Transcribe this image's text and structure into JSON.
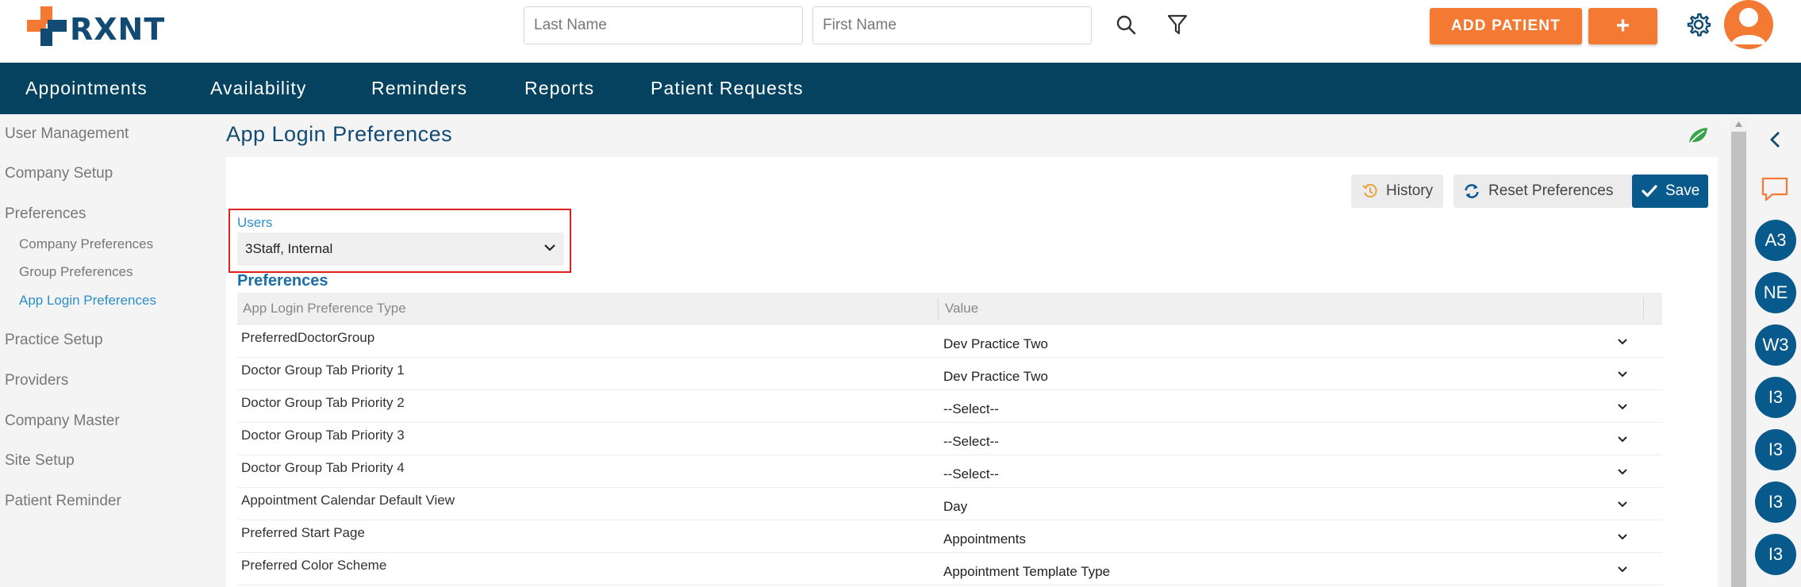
{
  "brand": {
    "name": "RXNT",
    "primary_color": "#05425f",
    "accent_color": "#f47a34"
  },
  "header": {
    "last_name_placeholder": "Last Name",
    "first_name_placeholder": "First Name",
    "add_patient_label": "ADD PATIENT",
    "plus_label": "+",
    "icons": [
      "search-icon",
      "filter-icon",
      "gear-icon",
      "user-avatar-icon"
    ]
  },
  "nav": {
    "items": [
      "Appointments",
      "Availability",
      "Reminders",
      "Reports",
      "Patient Requests"
    ]
  },
  "sidebar": {
    "items": [
      {
        "label": "User Management"
      },
      {
        "label": "Company Setup"
      },
      {
        "label": "Preferences"
      },
      {
        "label": "Company Preferences"
      },
      {
        "label": "Group Preferences"
      },
      {
        "label": "App Login Preferences",
        "active": true
      },
      {
        "label": "Practice Setup"
      },
      {
        "label": "Providers"
      },
      {
        "label": "Company Master"
      },
      {
        "label": "Site Setup"
      },
      {
        "label": "Patient Reminder"
      }
    ]
  },
  "page": {
    "title": "App Login Preferences",
    "toolbar": {
      "history_label": "History",
      "reset_label": "Reset Preferences",
      "save_label": "Save"
    },
    "users": {
      "label": "Users",
      "selected": "3Staff, Internal"
    },
    "preferences_heading": "Preferences",
    "table": {
      "columns": [
        "App Login Preference Type",
        "Value"
      ],
      "rows": [
        {
          "type": "PreferredDoctorGroup",
          "value": "Dev Practice Two"
        },
        {
          "type": "Doctor Group Tab Priority 1",
          "value": "Dev Practice Two"
        },
        {
          "type": "Doctor Group Tab Priority 2",
          "value": "--Select--"
        },
        {
          "type": "Doctor Group Tab Priority 3",
          "value": "--Select--"
        },
        {
          "type": "Doctor Group Tab Priority 4",
          "value": "--Select--"
        },
        {
          "type": "Appointment Calendar Default View",
          "value": "Day"
        },
        {
          "type": "Preferred Start Page",
          "value": "Appointments"
        },
        {
          "type": "Preferred Color Scheme",
          "value": "Appointment Template Type"
        }
      ]
    }
  },
  "rail": {
    "avatars": [
      "A3",
      "NE",
      "W3",
      "I3",
      "I3",
      "I3",
      "I3"
    ]
  }
}
